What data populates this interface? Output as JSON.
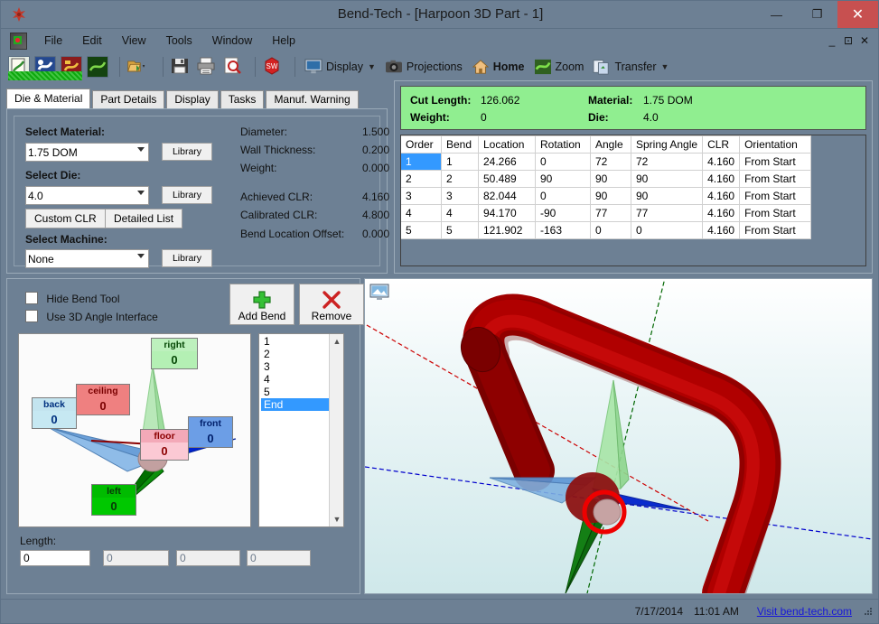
{
  "window": {
    "title": "Bend-Tech - [Harpoon 3D Part - 1]",
    "logo_icon": "bendtech-logo-icon",
    "minimize": "—",
    "maximize": "❐",
    "close": "✕"
  },
  "menu": {
    "app_icon": "bendtech-mdi-icon",
    "items": [
      "File",
      "Edit",
      "View",
      "Tools",
      "Window",
      "Help"
    ],
    "mdi_min": "_",
    "mdi_restore": "⊡",
    "mdi_close": "✕"
  },
  "toolbar": {
    "icons": [
      {
        "name": "new-part-icon",
        "title": "New Part"
      },
      {
        "name": "new-assembly-icon",
        "title": "New Assembly"
      },
      {
        "name": "new-design-icon",
        "title": "New Design"
      },
      {
        "name": "new-tube-icon",
        "title": "New Tube"
      },
      {
        "name": "open-folder-icon",
        "title": "Open"
      },
      {
        "name": "save-icon",
        "title": "Save"
      },
      {
        "name": "print-icon",
        "title": "Print"
      },
      {
        "name": "print-preview-icon",
        "title": "Print Preview"
      },
      {
        "name": "solidworks-icon",
        "title": "SolidWorks"
      }
    ],
    "buttons": [
      {
        "name": "display-button",
        "label": "Display",
        "icon": "monitor-icon",
        "dropdown": true
      },
      {
        "name": "projections-button",
        "label": "Projections",
        "icon": "camera-icon",
        "dropdown": false
      },
      {
        "name": "home-button",
        "label": "Home",
        "icon": "house-icon",
        "dropdown": false,
        "bold": true
      },
      {
        "name": "zoom-button",
        "label": "Zoom",
        "icon": "zoom-icon",
        "dropdown": false
      },
      {
        "name": "transfer-button",
        "label": "Transfer",
        "icon": "transfer-icon",
        "dropdown": true
      }
    ]
  },
  "tabs": [
    {
      "label": "Die & Material",
      "active": true
    },
    {
      "label": "Part Details",
      "active": false
    },
    {
      "label": "Display",
      "active": false
    },
    {
      "label": "Tasks",
      "active": false
    },
    {
      "label": "Manuf. Warning",
      "active": false
    }
  ],
  "die_material": {
    "select_material_label": "Select Material:",
    "material_value": "1.75 DOM",
    "select_die_label": "Select Die:",
    "die_value": "4.0",
    "select_machine_label": "Select Machine:",
    "machine_value": "None",
    "library_label": "Library",
    "custom_clr_label": "Custom CLR",
    "detailed_list_label": "Detailed List",
    "properties": [
      {
        "label": "Diameter:",
        "value": "1.500"
      },
      {
        "label": "Wall Thickness:",
        "value": "0.200"
      },
      {
        "label": "Weight:",
        "value": "0.000"
      },
      {
        "label": "Achieved CLR:",
        "value": "4.160"
      },
      {
        "label": "Calibrated CLR:",
        "value": "4.800"
      },
      {
        "label": "Bend Location Offset:",
        "value": "0.000"
      }
    ]
  },
  "summary": {
    "cut_length_label": "Cut Length:",
    "cut_length_value": "126.062",
    "weight_label": "Weight:",
    "weight_value": "0",
    "material_label": "Material:",
    "material_value": "1.75 DOM",
    "die_label": "Die:",
    "die_value": "4.0",
    "background": "#90ee90"
  },
  "bend_table": {
    "columns": [
      "Order",
      "Bend",
      "Location",
      "Rotation",
      "Angle",
      "Spring Angle",
      "CLR",
      "Orientation"
    ],
    "selected_row": 0,
    "rows": [
      [
        "1",
        "1",
        "24.266",
        "0",
        "72",
        "72",
        "4.160",
        "From Start"
      ],
      [
        "2",
        "2",
        "50.489",
        "90",
        "90",
        "90",
        "4.160",
        "From Start"
      ],
      [
        "3",
        "3",
        "82.044",
        "0",
        "90",
        "90",
        "4.160",
        "From Start"
      ],
      [
        "4",
        "4",
        "94.170",
        "-90",
        "77",
        "77",
        "4.160",
        "From Start"
      ],
      [
        "5",
        "5",
        "121.902",
        "-163",
        "0",
        "0",
        "4.160",
        "From Start"
      ]
    ]
  },
  "bend_tool": {
    "hide_bend_tool_label": "Hide Bend Tool",
    "hide_bend_tool_checked": false,
    "use_3d_angle_label": "Use 3D Angle Interface",
    "use_3d_angle_checked": false,
    "add_bend_label": "Add Bend",
    "add_bend_icon": "plus-icon",
    "remove_label": "Remove",
    "remove_icon": "x-icon",
    "nodes": [
      {
        "name": "right",
        "value": "0",
        "title_bg": "#bdf0bd",
        "value_bg": "#b4f0b4",
        "text": "#006000"
      },
      {
        "name": "ceiling",
        "value": "0",
        "title_bg": "#ef8080",
        "value_bg": "#ef8080",
        "text": "#8b0000"
      },
      {
        "name": "back",
        "value": "0",
        "title_bg": "#c3e4ef",
        "value_bg": "#c6e8f2",
        "text": "#00307f"
      },
      {
        "name": "front",
        "value": "0",
        "title_bg": "#6c9ee6",
        "value_bg": "#6c9ee6",
        "text": "#001f6b"
      },
      {
        "name": "floor",
        "value": "0",
        "title_bg": "#f3a9b8",
        "value_bg": "#fbc9d4",
        "text": "#8b0000"
      },
      {
        "name": "left",
        "value": "0",
        "title_bg": "#00bb00",
        "value_bg": "#00c800",
        "text": "#003000"
      }
    ],
    "list_items": [
      "1",
      "2",
      "3",
      "4",
      "5",
      "End"
    ],
    "list_selected": "End",
    "length_label": "Length:",
    "length_values": [
      "0",
      "0",
      "0",
      "0"
    ]
  },
  "viewport": {
    "icon": "screen-capture-icon"
  },
  "statusbar": {
    "date": "7/17/2014",
    "time": "11:01 AM",
    "link": "Visit bend-tech.com"
  }
}
